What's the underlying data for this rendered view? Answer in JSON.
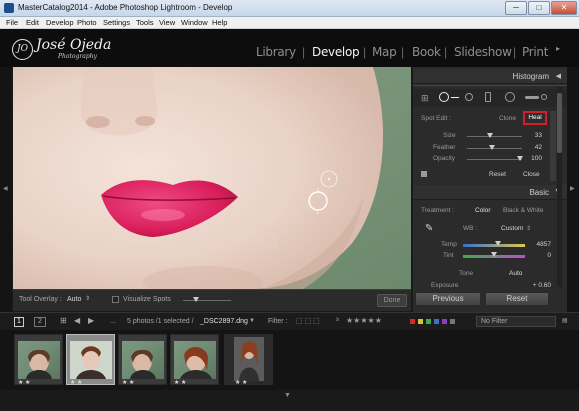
{
  "window": {
    "title": "MasterCatalog2014 - Adobe Photoshop Lightroom - Develop",
    "minimize": "─",
    "maximize": "□",
    "close": "✕"
  },
  "menu": [
    "File",
    "Edit",
    "Develop",
    "Photo",
    "Settings",
    "Tools",
    "View",
    "Window",
    "Help"
  ],
  "identity": {
    "name": "José Ojeda",
    "monogram": "JO",
    "subtitle": "Photography"
  },
  "modules": [
    {
      "label": "Library",
      "active": false
    },
    {
      "label": "Develop",
      "active": true
    },
    {
      "label": "Map",
      "active": false
    },
    {
      "label": "Book",
      "active": false
    },
    {
      "label": "Slideshow",
      "active": false
    },
    {
      "label": "Print",
      "active": false
    }
  ],
  "toolbar": {
    "tool_overlay_label": "Tool Overlay :",
    "tool_overlay_value": "Auto",
    "visualize_spots_label": "Visualize Spots",
    "done_label": "Done"
  },
  "panel": {
    "histogram_title": "Histogram",
    "spot_edit_label": "Spot Edit :",
    "clone_label": "Clone",
    "heal_label": "Heal",
    "sliders": [
      {
        "label": "Size",
        "value": "33",
        "pos": 0.42
      },
      {
        "label": "Feather",
        "value": "42",
        "pos": 0.45
      },
      {
        "label": "Opacity",
        "value": "100",
        "pos": 0.97
      }
    ],
    "reset_label": "Reset",
    "close_label": "Close",
    "basic_title": "Basic",
    "treatment_label": "Treatment :",
    "color_label": "Color",
    "bw_label": "Black & White",
    "wb_label": "WB :",
    "wb_value": "Custom",
    "temp_label": "Temp",
    "temp_value": "4857",
    "tint_label": "Tint",
    "tint_value": "0",
    "tone_label": "Tone",
    "auto_label": "Auto",
    "exposure_label": "Exposure",
    "exposure_value": "+ 0.60",
    "previous_label": "Previous",
    "reset_button_label": "Reset"
  },
  "filmbar": {
    "page1": "1",
    "page2": "2",
    "source_prefix": "...",
    "info_text": "5 photos /1 selected /",
    "filename": "_DSC2897.dng",
    "filter_label": "Filter :",
    "no_filter": "No Filter"
  },
  "colors": {
    "heal_highlight": "#d0202a",
    "lip": "#e0225f",
    "skin": "#eedbd0",
    "background_green": "#7f9a7e"
  },
  "thumbnails": [
    "photo-1",
    "photo-2",
    "photo-3",
    "photo-4",
    "photo-5"
  ],
  "thumb_rating": "★ ★"
}
